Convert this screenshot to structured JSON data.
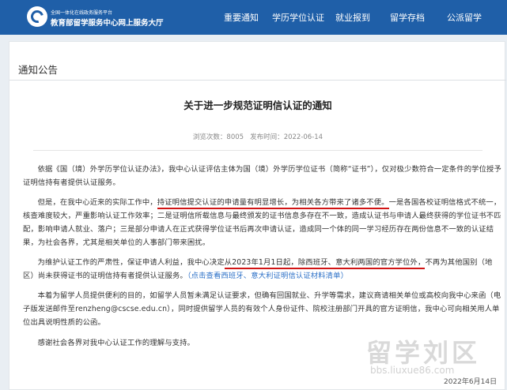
{
  "header": {
    "brand_top": "全国一体化在线政务服务平台",
    "brand_main": "教育部留学服务中心网上服务大厅",
    "nav": [
      "重要通知",
      "学历学位认证",
      "就业报到",
      "留学存档",
      "公派留学"
    ]
  },
  "page": {
    "section_title": "通知公告",
    "doc_title": "关于进一步规范证明信认证的通知",
    "views_label": "浏览次数：",
    "views": "8005",
    "date_label": "发布时间：",
    "date": "2022-06-14"
  },
  "content": {
    "p1": "依据《国（境）外学历学位认证办法》，我中心认证评估主体为国（境）外学历学位证书（简称“证书”），仅对极少数符合一定条件的学位授予证明信持有者提供认证服务。",
    "p2a": "但是，在我中心近来的实际工作中，",
    "p2u": "持证明信提交认证的申请量有明显增长，为相关各方带来了诸多不便。",
    "p2b": "一是各国各校证明信格式不统一，核查难度较大，严重影响认证工作效率；二是证明信所载信息与最终颁发的证书信息多存在不一致，造成认证书与申请人最终获得的学位证书不匹配，影响申请人就业、落户；三是部分申请人在正式获得学位证书后再次申请认证，造成同一个体的同一学习经历存在两份信息不一致的认证结果，为社会各界，尤其是相关单位的人事部门带来困扰。",
    "p3a": "为维护认证工作的严肃性，保证申请人利益，我中心决定",
    "p3u": "从2023年1月1日起，除西班牙、意大利两国的官方学位外，",
    "p3b": "不再为其他国别（地区）尚未获得证书的证明信持有者提供认证服务。",
    "p3link": "（点击查看西班牙、意大利证明信认证材料清单）",
    "p4": "本着为留学人员提供便利的目的，如留学人员暂未满足认证要求，但确有回国就业、升学等需求，建议商请相关单位或高校向我中心来函（电子版发送邮件至renzheng@cscse.edu.cn），同时提供留学人员的有效个人身份证件、院校注册部门开具的官方证明信，我中心可向相关用人单位出具说明性质的公函。",
    "p5": "感谢社会各界对我中心认证工作的理解与支持。"
  },
  "overlay": {
    "watermark": "留学刘区",
    "watermark_url": "bbs.liuxue86.com",
    "date_stamp": "2022年6月14日"
  },
  "colors": {
    "header_bg": "#1f5fa8",
    "underline": "#d01515",
    "link": "#2a6fc7"
  }
}
